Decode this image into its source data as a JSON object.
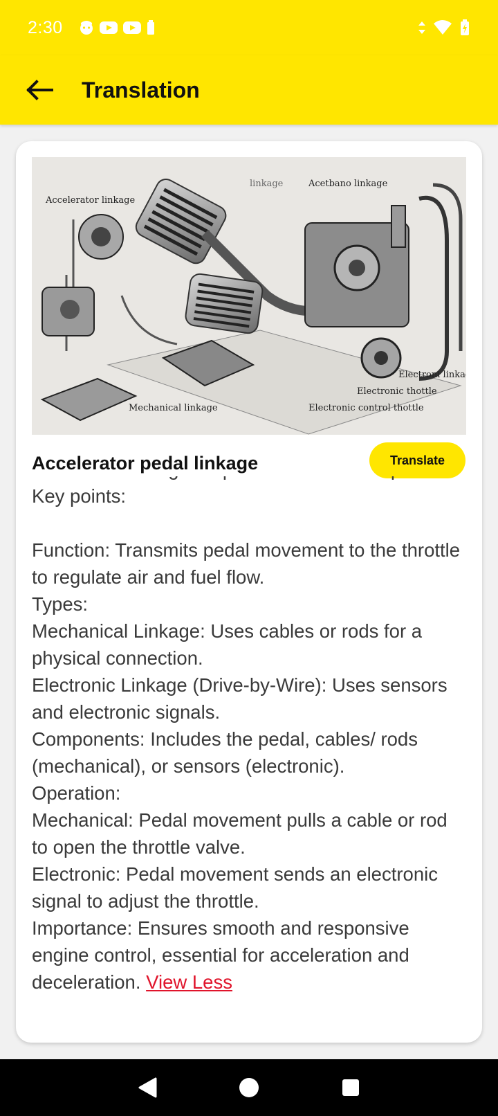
{
  "status_bar": {
    "time": "2:30",
    "left_icons": [
      "face-icon",
      "youtube-icon",
      "youtube-icon",
      "battery-saver-icon"
    ],
    "right_icons": [
      "data-arrows-icon",
      "wifi-icon",
      "battery-charging-icon"
    ]
  },
  "app_bar": {
    "title": "Translation",
    "back_icon": "arrow-left-icon"
  },
  "card": {
    "image_labels": {
      "accelerator_linkage": "Accelerator linkage",
      "linkage_top": "linkage",
      "acetbano_linkage": "Acetbano linkage",
      "electronic_linkage": "Electroni linkage",
      "electronic_thottle": "Electronic thottle",
      "electronic_control_thottle": "Electronic control thottle",
      "mechanical_linkage": "Mechanical linkage"
    },
    "title": "Accelerator pedal linkage",
    "translate_label": "Translate",
    "body_text": "to control the engine's power and vehicle speed. Key points:\n\nFunction: Transmits pedal movement to the throttle to regulate air and fuel flow.\nTypes:\nMechanical Linkage: Uses cables or rods for a physical connection.\nElectronic Linkage (Drive-by-Wire): Uses sensors and electronic signals.\nComponents: Includes the pedal, cables/ rods (mechanical), or sensors (electronic).\nOperation:\nMechanical: Pedal movement pulls a cable or rod to open the throttle valve.\nElectronic: Pedal movement sends an electronic signal to adjust the throttle.\nImportance: Ensures smooth and responsive engine control, essential for acceleration and deceleration. ",
    "view_less_label": "View Less"
  },
  "colors": {
    "accent": "#ffe600",
    "link": "#e0142b"
  }
}
